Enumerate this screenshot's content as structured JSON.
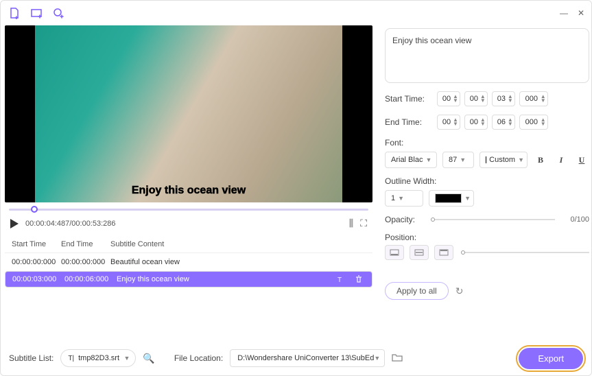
{
  "titlebar": {
    "icons": [
      "add-file-icon",
      "add-folder-icon",
      "add-url-icon"
    ]
  },
  "video": {
    "overlay_text": "Enjoy this ocean view"
  },
  "controls": {
    "timecode": "00:00:04:487/00:00:53:286"
  },
  "subtable": {
    "headers": {
      "start": "Start Time",
      "end": "End Time",
      "content": "Subtitle Content"
    },
    "rows": [
      {
        "start": "00:00:00:000",
        "end": "00:00:00:000",
        "content": "Beautiful ocean view",
        "selected": false
      },
      {
        "start": "00:00:03:000",
        "end": "00:00:06:000",
        "content": "Enjoy this ocean view",
        "selected": true
      }
    ]
  },
  "editor": {
    "text": "Enjoy this ocean view",
    "start_label": "Start Time:",
    "end_label": "End Time:",
    "start": {
      "h": "00",
      "m": "00",
      "s": "03",
      "ms": "000"
    },
    "end": {
      "h": "00",
      "m": "00",
      "s": "06",
      "ms": "000"
    },
    "font_label": "Font:",
    "font_name": "Arial Blac",
    "font_size": "87",
    "color_name": "Custom",
    "outline_label": "Outline Width:",
    "outline_width": "1",
    "opacity_label": "Opacity:",
    "opacity_value": "0/100",
    "position_label": "Position:",
    "apply_label": "Apply to all"
  },
  "bottom": {
    "subtitle_list_label": "Subtitle List:",
    "subtitle_file": "tmp82D3.srt",
    "file_location_label": "File Location:",
    "file_location": "D:\\Wondershare UniConverter 13\\SubEd",
    "export_label": "Export"
  }
}
